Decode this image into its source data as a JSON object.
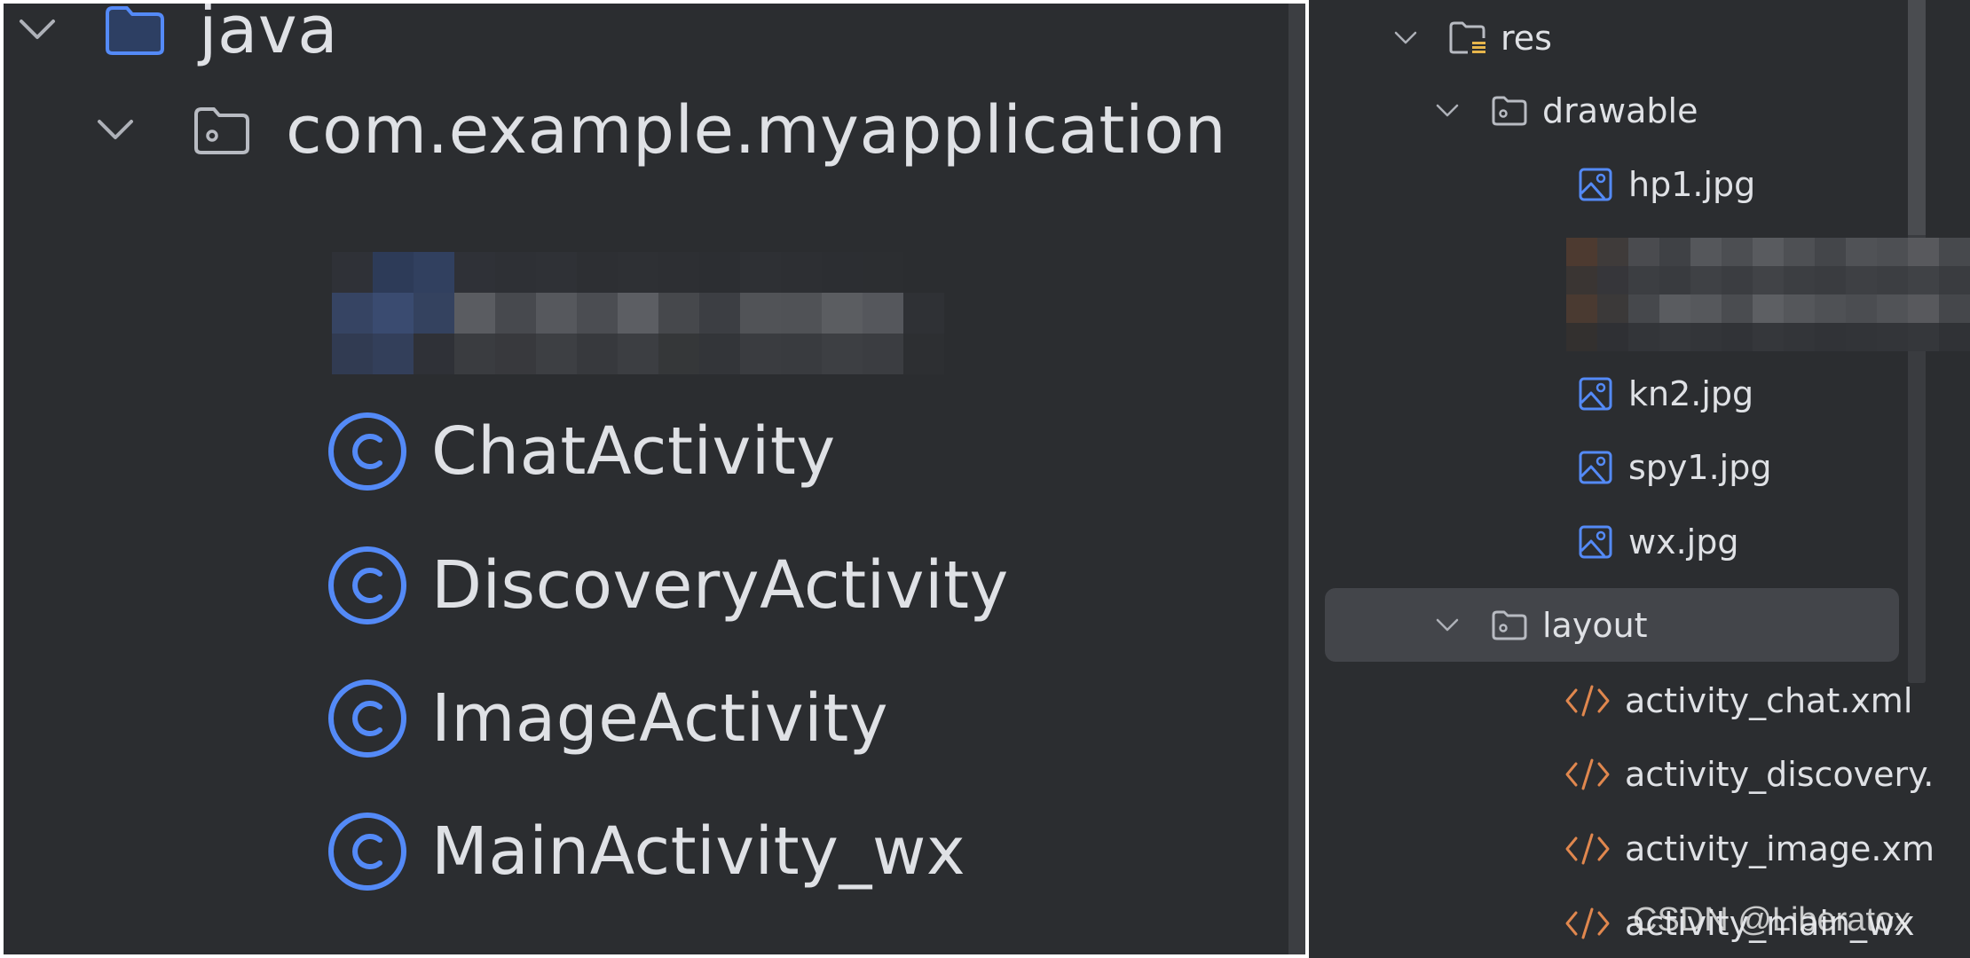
{
  "left_tree": {
    "root": {
      "label": "java",
      "expanded": true,
      "icon": "folder-icon"
    },
    "package": {
      "label": "com.example.myapplication",
      "expanded": true,
      "icon": "package-icon"
    },
    "classes": [
      {
        "label": "ChatActivity",
        "icon": "class-icon"
      },
      {
        "label": "DiscoveryActivity",
        "icon": "class-icon"
      },
      {
        "label": "ImageActivity",
        "icon": "class-icon"
      },
      {
        "label": "MainActivity_wx",
        "icon": "class-icon"
      }
    ],
    "redacted_item": true
  },
  "right_tree": {
    "res": {
      "label": "res",
      "expanded": true,
      "icon": "resource-folder-icon"
    },
    "drawable": {
      "label": "drawable",
      "expanded": true,
      "icon": "package-icon"
    },
    "drawable_files": [
      {
        "label": "hp1.jpg",
        "icon": "image-file-icon"
      },
      {
        "label": "kn2.jpg",
        "icon": "image-file-icon"
      },
      {
        "label": "spy1.jpg",
        "icon": "image-file-icon"
      },
      {
        "label": "wx.jpg",
        "icon": "image-file-icon"
      }
    ],
    "layout": {
      "label": "layout",
      "expanded": true,
      "selected": true,
      "icon": "package-icon"
    },
    "layout_files": [
      {
        "label": "activity_chat.xml",
        "icon": "xml-file-icon"
      },
      {
        "label": "activity_discovery.",
        "icon": "xml-file-icon"
      },
      {
        "label": "activity_image.xm",
        "icon": "xml-file-icon"
      },
      {
        "label": "activity_main_wx",
        "icon": "xml-file-icon"
      }
    ]
  },
  "watermark": "CSDN @Liberatox",
  "colors": {
    "background": "#2b2d30",
    "text": "#dfe1e5",
    "accent_blue": "#548af7",
    "folder_fill": "#2d3f63",
    "xml_orange": "#e0874e",
    "selected_row": "#43454a"
  }
}
